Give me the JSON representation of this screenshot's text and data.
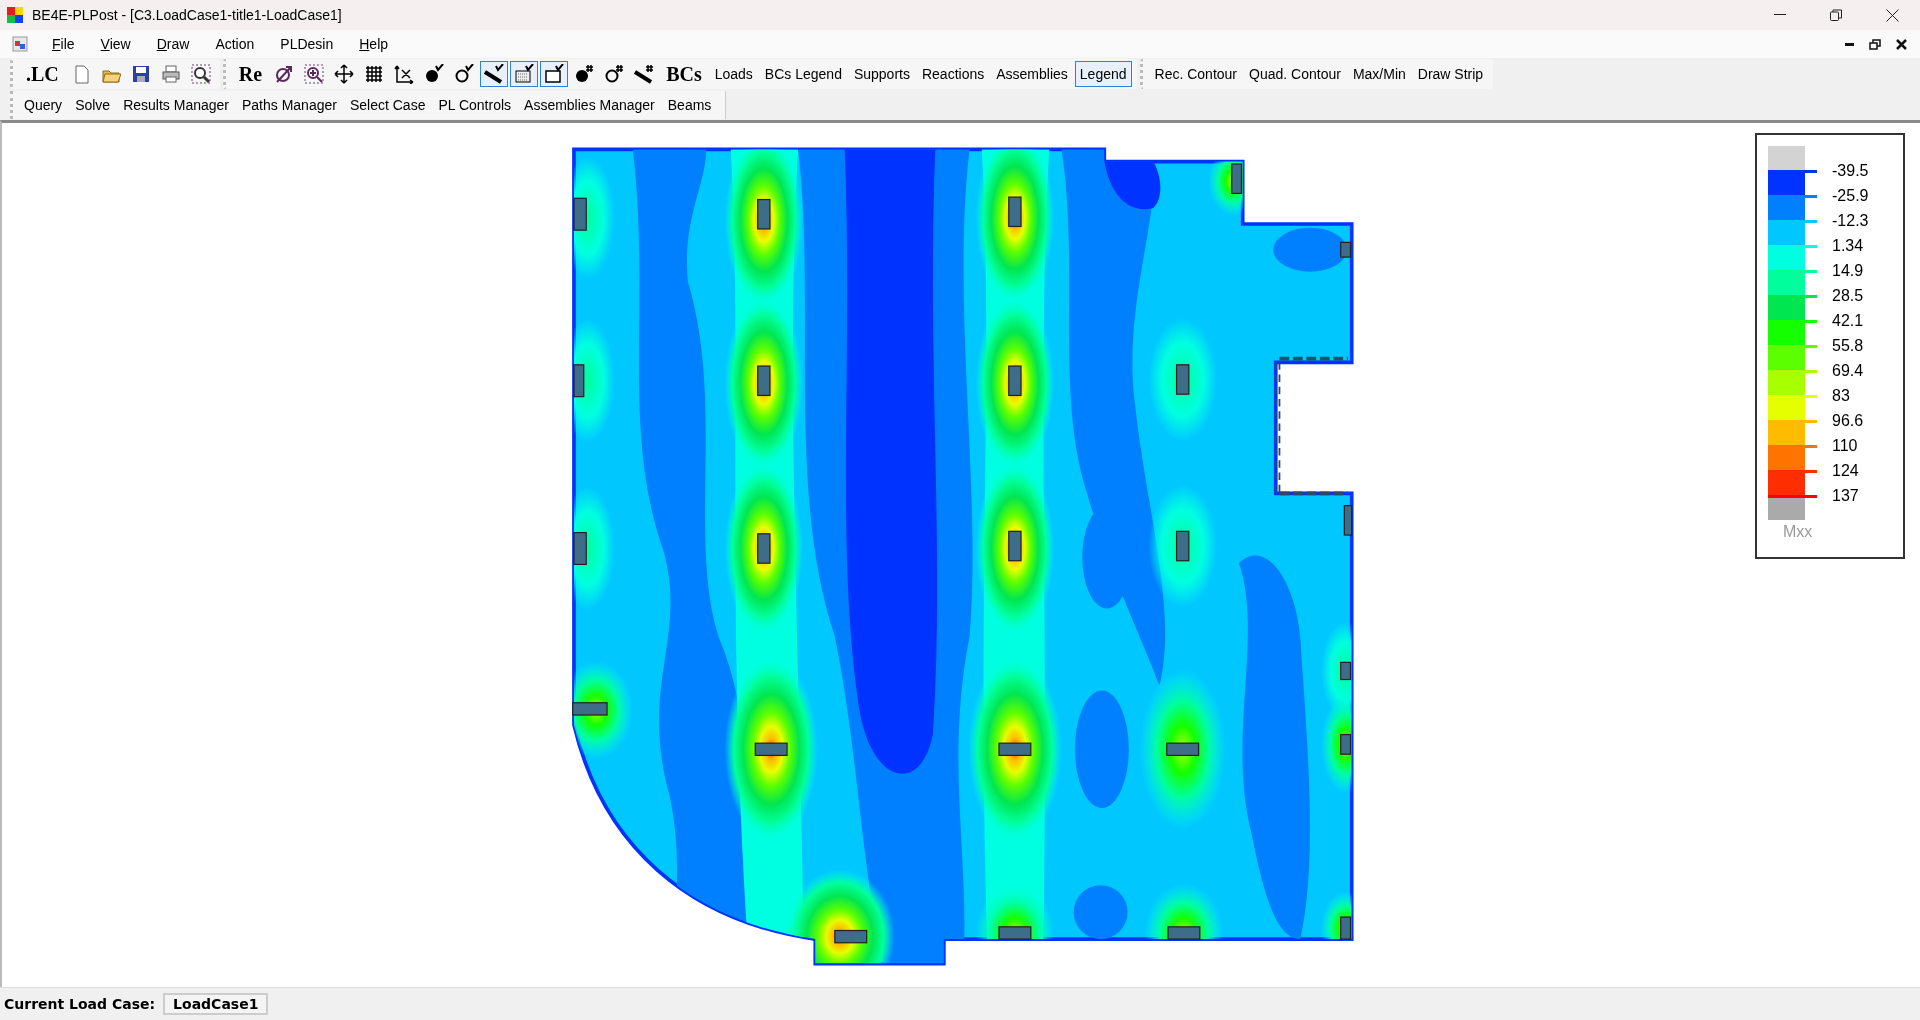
{
  "window": {
    "title": "BE4E-PLPost - [C3.LoadCase1-title1-LoadCase1]"
  },
  "menu": [
    {
      "label": "File",
      "underlined_key": true
    },
    {
      "label": "View",
      "underlined_key": true
    },
    {
      "label": "Draw",
      "underlined_key": true
    },
    {
      "label": "Action",
      "underlined_key": false
    },
    {
      "label": "PLDesin",
      "underlined_key": false
    },
    {
      "label": "Help",
      "underlined_key": true
    }
  ],
  "toolbar": {
    "groups": [
      [
        {
          "kind": "glyph",
          "label": ".LC",
          "selected": false
        },
        {
          "kind": "icon",
          "selected": false
        },
        {
          "kind": "icon",
          "selected": false
        },
        {
          "kind": "icon",
          "selected": false
        },
        {
          "kind": "icon",
          "selected": false
        },
        {
          "kind": "icon",
          "selected": false
        }
      ],
      [
        {
          "kind": "glyph",
          "label": "Re",
          "selected": false
        },
        {
          "kind": "icon",
          "selected": false
        },
        {
          "kind": "icon",
          "selected": false
        },
        {
          "kind": "icon",
          "selected": false
        },
        {
          "kind": "icon",
          "selected": false
        },
        {
          "kind": "icon",
          "selected": false
        },
        {
          "kind": "icon",
          "selected": false
        },
        {
          "kind": "icon",
          "selected": false
        },
        {
          "kind": "icon",
          "selected": true
        },
        {
          "kind": "icon",
          "selected": true
        },
        {
          "kind": "icon",
          "selected": true
        },
        {
          "kind": "icon",
          "selected": false
        },
        {
          "kind": "icon",
          "selected": false
        },
        {
          "kind": "icon",
          "selected": false
        },
        {
          "kind": "glyph",
          "label": "BCs",
          "selected": false
        },
        {
          "kind": "text",
          "label": "Loads",
          "selected": false
        },
        {
          "kind": "text",
          "label": "BCs Legend",
          "selected": false
        },
        {
          "kind": "text",
          "label": "Supports",
          "selected": false
        },
        {
          "kind": "text",
          "label": "Reactions",
          "selected": false
        },
        {
          "kind": "text",
          "label": "Assemblies",
          "selected": false
        },
        {
          "kind": "text",
          "label": "Legend",
          "selected": true
        }
      ],
      [
        {
          "kind": "text",
          "label": "Rec. Contour",
          "selected": false
        },
        {
          "kind": "text",
          "label": "Quad. Contour",
          "selected": false
        },
        {
          "kind": "text",
          "label": "Max/Min",
          "selected": false
        },
        {
          "kind": "text",
          "label": "Draw Strip",
          "selected": false
        }
      ]
    ]
  },
  "toolbar2": [
    "Query",
    "Solve",
    "Results Manager",
    "Paths Manager",
    "Select Case",
    "PL Controls",
    "Assemblies Manager",
    "Beams"
  ],
  "legend": {
    "title": "Mxx",
    "levels": [
      {
        "label": "-39.5",
        "color": "#0033ff"
      },
      {
        "label": "-25.9",
        "color": "#0080ff"
      },
      {
        "label": "-12.3",
        "color": "#00c8ff"
      },
      {
        "label": "1.34",
        "color": "#00ffe0"
      },
      {
        "label": "14.9",
        "color": "#00ff9c"
      },
      {
        "label": "28.5",
        "color": "#00e650"
      },
      {
        "label": "42.1",
        "color": "#14ff00"
      },
      {
        "label": "55.8",
        "color": "#5cff00"
      },
      {
        "label": "69.4",
        "color": "#a8ff00"
      },
      {
        "label": "83",
        "color": "#e6ff00"
      },
      {
        "label": "96.6",
        "color": "#ffbb00"
      },
      {
        "label": "110",
        "color": "#ff7300"
      },
      {
        "label": "124",
        "color": "#ff2e00"
      },
      {
        "label": "137",
        "color": "#ff0000"
      }
    ]
  },
  "status_bar": {
    "label": "Current Load Case:",
    "value": "LoadCase1"
  }
}
